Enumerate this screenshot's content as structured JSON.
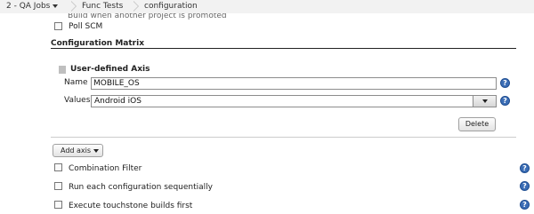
{
  "breadcrumb": {
    "items": [
      {
        "label": "2 - QA Jobs",
        "has_menu": true
      },
      {
        "label": "Func Tests",
        "has_menu": false
      },
      {
        "label": "configuration",
        "has_menu": false
      }
    ]
  },
  "build_triggers": {
    "cutoff_label": "Build when another project is promoted",
    "poll_scm": {
      "label": "Poll SCM",
      "checked": false
    }
  },
  "configuration_matrix": {
    "title": "Configuration Matrix",
    "axis": {
      "title": "User-defined Axis",
      "name_label": "Name",
      "name_value": "MOBILE_OS",
      "values_label": "Values",
      "values_value": "Android iOS",
      "delete_label": "Delete"
    },
    "add_axis_label": "Add axis",
    "options": [
      {
        "label": "Combination Filter",
        "checked": false
      },
      {
        "label": "Run each configuration sequentially",
        "checked": false
      },
      {
        "label": "Execute touchstone builds first",
        "checked": false
      }
    ]
  },
  "help_icon_glyph": "?",
  "colors": {
    "help_icon": "#3b6db5",
    "breadcrumb_bg": "#f2f2f2"
  }
}
